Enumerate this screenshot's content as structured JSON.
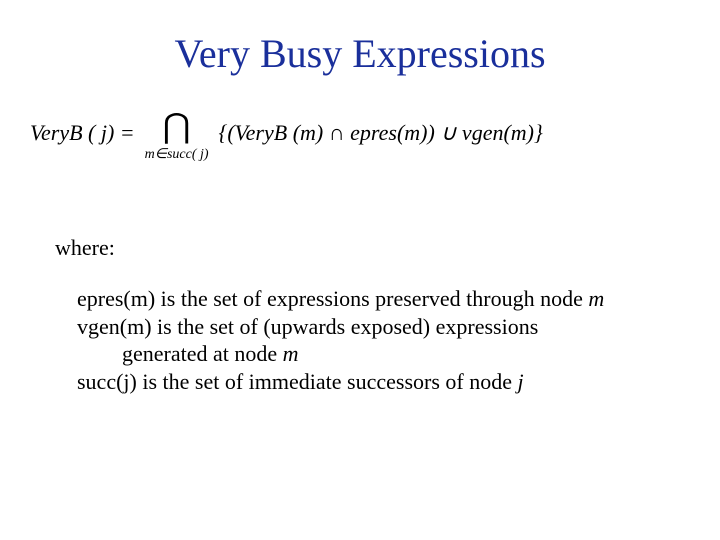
{
  "title": "Very Busy Expressions",
  "formula": {
    "lhs": "VeryB ( j) =",
    "operator_symbol": "⋂",
    "operator_sub": "m∈succ( j)",
    "rhs": "{(VeryB (m) ∩ epres(m)) ∪ vgen(m)}"
  },
  "where_label": "where:",
  "definitions": {
    "line1": "epres(m) is the set of expressions preserved through node ",
    "line1_var": "m",
    "line2": "vgen(m) is the set of (upwards exposed) expressions",
    "line2b": "generated at node ",
    "line2b_var": "m",
    "line3": "succ(j) is the set of immediate successors of node ",
    "line3_var": "j"
  }
}
